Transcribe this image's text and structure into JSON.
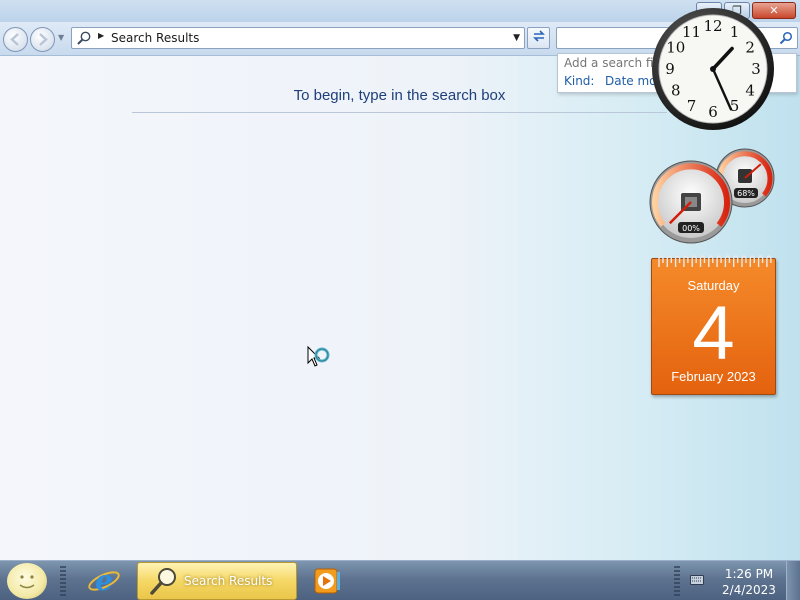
{
  "window": {
    "caption": {
      "minimize": "–",
      "maximize": "❐",
      "close": "✕"
    }
  },
  "address_bar": {
    "path": "Search Results",
    "refresh_icon": "refresh-icon"
  },
  "search": {
    "placeholder": "",
    "filter_hint": "Add a search filte",
    "filter_kind": "Kind:",
    "filter_date": "Date mod"
  },
  "main": {
    "message": "To begin, type in the search box"
  },
  "gadgets": {
    "clock": {
      "numerals": [
        "12",
        "1",
        "2",
        "3",
        "4",
        "5",
        "6",
        "7",
        "8",
        "9",
        "10",
        "11"
      ],
      "time": "1:26"
    },
    "cpu_meter": {
      "cpu_percent_label": "00%",
      "memory_percent_label": "68%",
      "cpu_value": 0,
      "memory_value": 68
    },
    "calendar": {
      "weekday": "Saturday",
      "day": "4",
      "month_year": "February 2023",
      "accent": "#e8660f"
    }
  },
  "taskbar": {
    "active_task": "Search Results",
    "tray_time": "1:26 PM",
    "tray_date": "2/4/2023"
  }
}
